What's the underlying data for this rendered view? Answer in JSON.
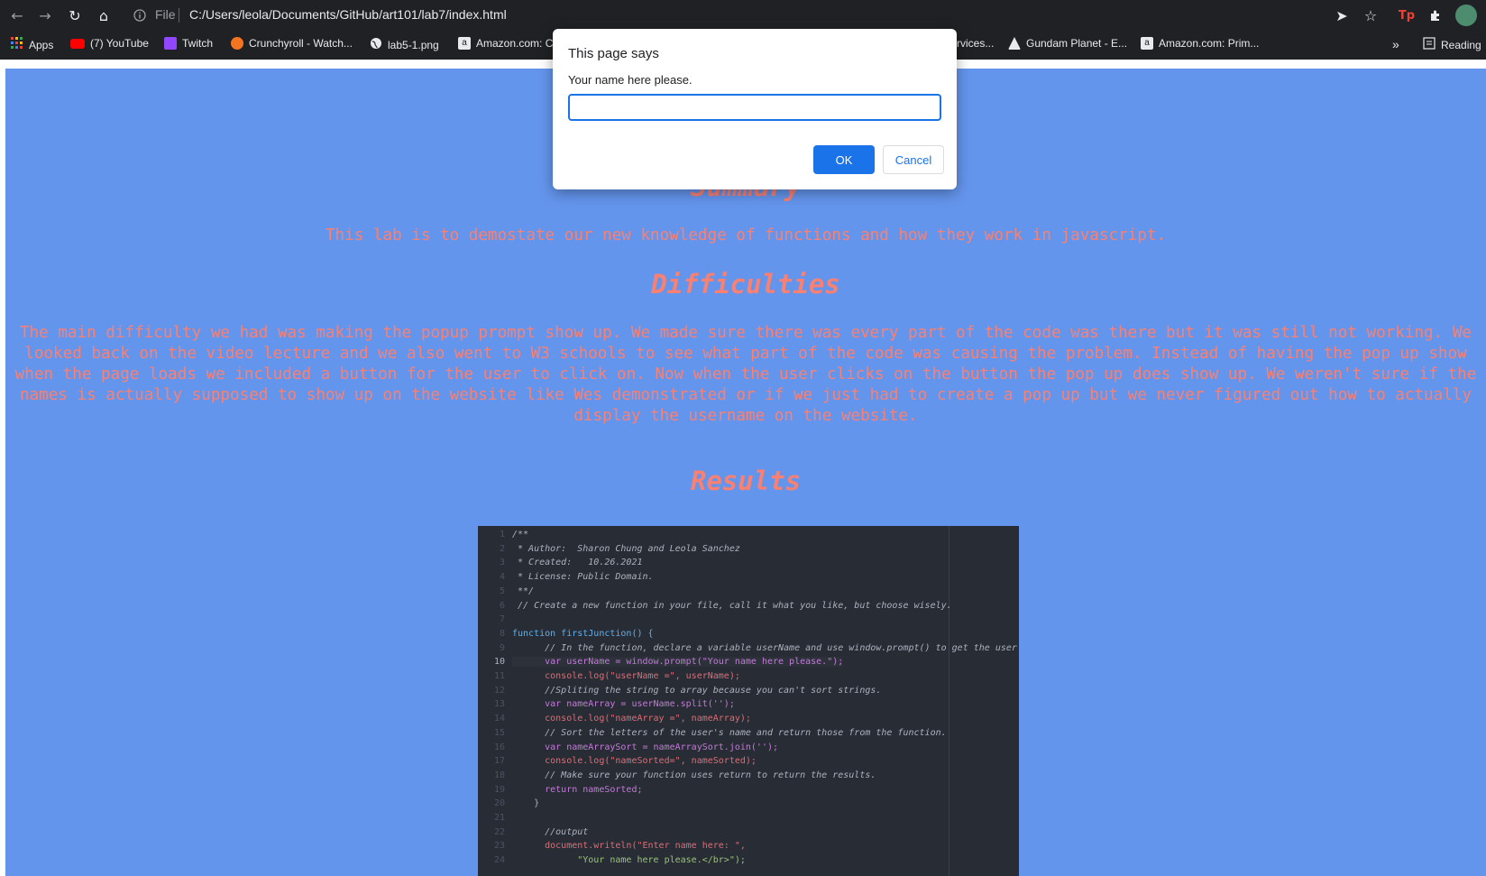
{
  "browser": {
    "file_label": "File",
    "url": "C:/Users/leola/Documents/GitHub/art101/lab7/index.html",
    "reading_label": "Reading"
  },
  "bookmarks": [
    {
      "label": "Apps",
      "icon": "apps-grid-icon",
      "color": "#ea4335"
    },
    {
      "label": "(7) YouTube",
      "icon": "youtube-icon",
      "color": "#ff0000"
    },
    {
      "label": "Twitch",
      "icon": "twitch-icon",
      "color": "#9146ff"
    },
    {
      "label": "Crunchyroll - Watch...",
      "icon": "crunchyroll-icon",
      "color": "#f47521"
    },
    {
      "label": "lab5-1.png",
      "icon": "globe-icon",
      "color": "#e8eaed"
    },
    {
      "label": "Amazon.com: C",
      "icon": "amazon-icon",
      "color": "#e8eaed"
    },
    {
      "label": "rvices...",
      "icon": "",
      "color": ""
    },
    {
      "label": "Gundam Planet - E...",
      "icon": "gundam-icon",
      "color": "#e8eaed"
    },
    {
      "label": "Amazon.com: Prim...",
      "icon": "amazon-icon",
      "color": "#e8eaed"
    }
  ],
  "page": {
    "summary_heading": "Summary",
    "summary_text": "This lab is to demostate our new knowledge of functions and how they work in javascript.",
    "difficulties_heading": "Difficulties",
    "difficulties_lines": [
      "The main difficulty we had was making the popup prompt show up. We made sure there was every part of the code was there but it was still not working. We",
      "looked back on the video lecture and we also went to W3 schools to see what part of the code was causing the problem. Instead of having the pop up show",
      "when the page loads we included a button for the user to click on. Now when the user clicks on the button the pop up does show up. We weren't sure if the",
      "names is actually supposed to show up on the website like Wes demonstrated or if we just had to create a pop up but we never figured out how to actually",
      "display the username on the website."
    ],
    "results_heading": "Results"
  },
  "code_lines": [
    "/**",
    " * Author:  Sharon Chung and Leola Sanchez",
    " * Created:   10.26.2021",
    " * License: Public Domain.",
    " **/",
    " // Create a new function in your file, call it what you like, but choose wisely.",
    "",
    "function firstJunction() {",
    "      // In the function, declare a variable userName and use window.prompt() to get the user'",
    "      var userName = window.prompt(\"Your name here please.\");",
    "      console.log(\"userName =\", userName);",
    "      //Spliting the string to array because you can't sort strings.",
    "      var nameArray = userName.split('');",
    "      console.log(\"nameArray =\", nameArray);",
    "      // Sort the letters of the user's name and return those from the function.",
    "      var nameArraySort = nameArraySort.join('');",
    "      console.log(\"nameSorted=\", nameSorted);",
    "      // Make sure your function uses return to return the results.",
    "      return nameSorted;",
    "    }",
    "",
    "      //output",
    "      document.writeln(\"Enter name here: \",",
    "            \"Your name here please.</br>\");"
  ],
  "dialog": {
    "title": "This page says",
    "message": "Your name here please.",
    "input_value": "",
    "ok_label": "OK",
    "cancel_label": "Cancel"
  },
  "colors": {
    "page_bg": "#6495ED",
    "text": "#FA8072",
    "dialog_accent": "#1a73e8"
  }
}
